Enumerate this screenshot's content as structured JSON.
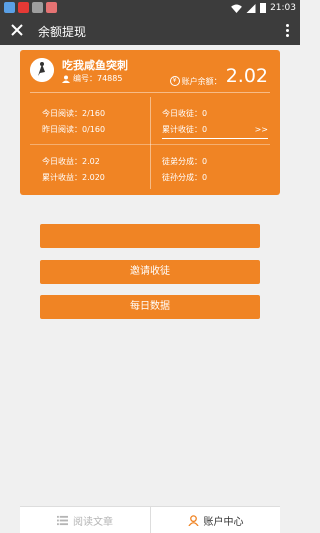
{
  "status_bar": {
    "time": "21:03"
  },
  "header": {
    "title": "余额提现"
  },
  "user": {
    "name": "吃我咸鱼突刺",
    "id_label": "编号：74885",
    "balance_label": "账户余额：",
    "balance": "2.02"
  },
  "stats": {
    "today_read": "今日阅读：2/160",
    "yesterday_read": "昨日阅读：0/160",
    "today_invite": "今日收徒：0",
    "total_invite": "累计收徒：0",
    "more": ">>",
    "today_income": "今日收益：2.02",
    "total_income": "累计收益：2.020",
    "disciple_share": "徒弟分成：0",
    "grand_disciple_share": "徒孙分成：0"
  },
  "buttons": {
    "first": "",
    "invite": "邀请收徒",
    "daily": "每日数据"
  },
  "bottom_nav": {
    "read": "阅读文章",
    "account": "账户中心"
  },
  "colors": {
    "accent": "#f08424",
    "header": "#3c3c3c"
  }
}
